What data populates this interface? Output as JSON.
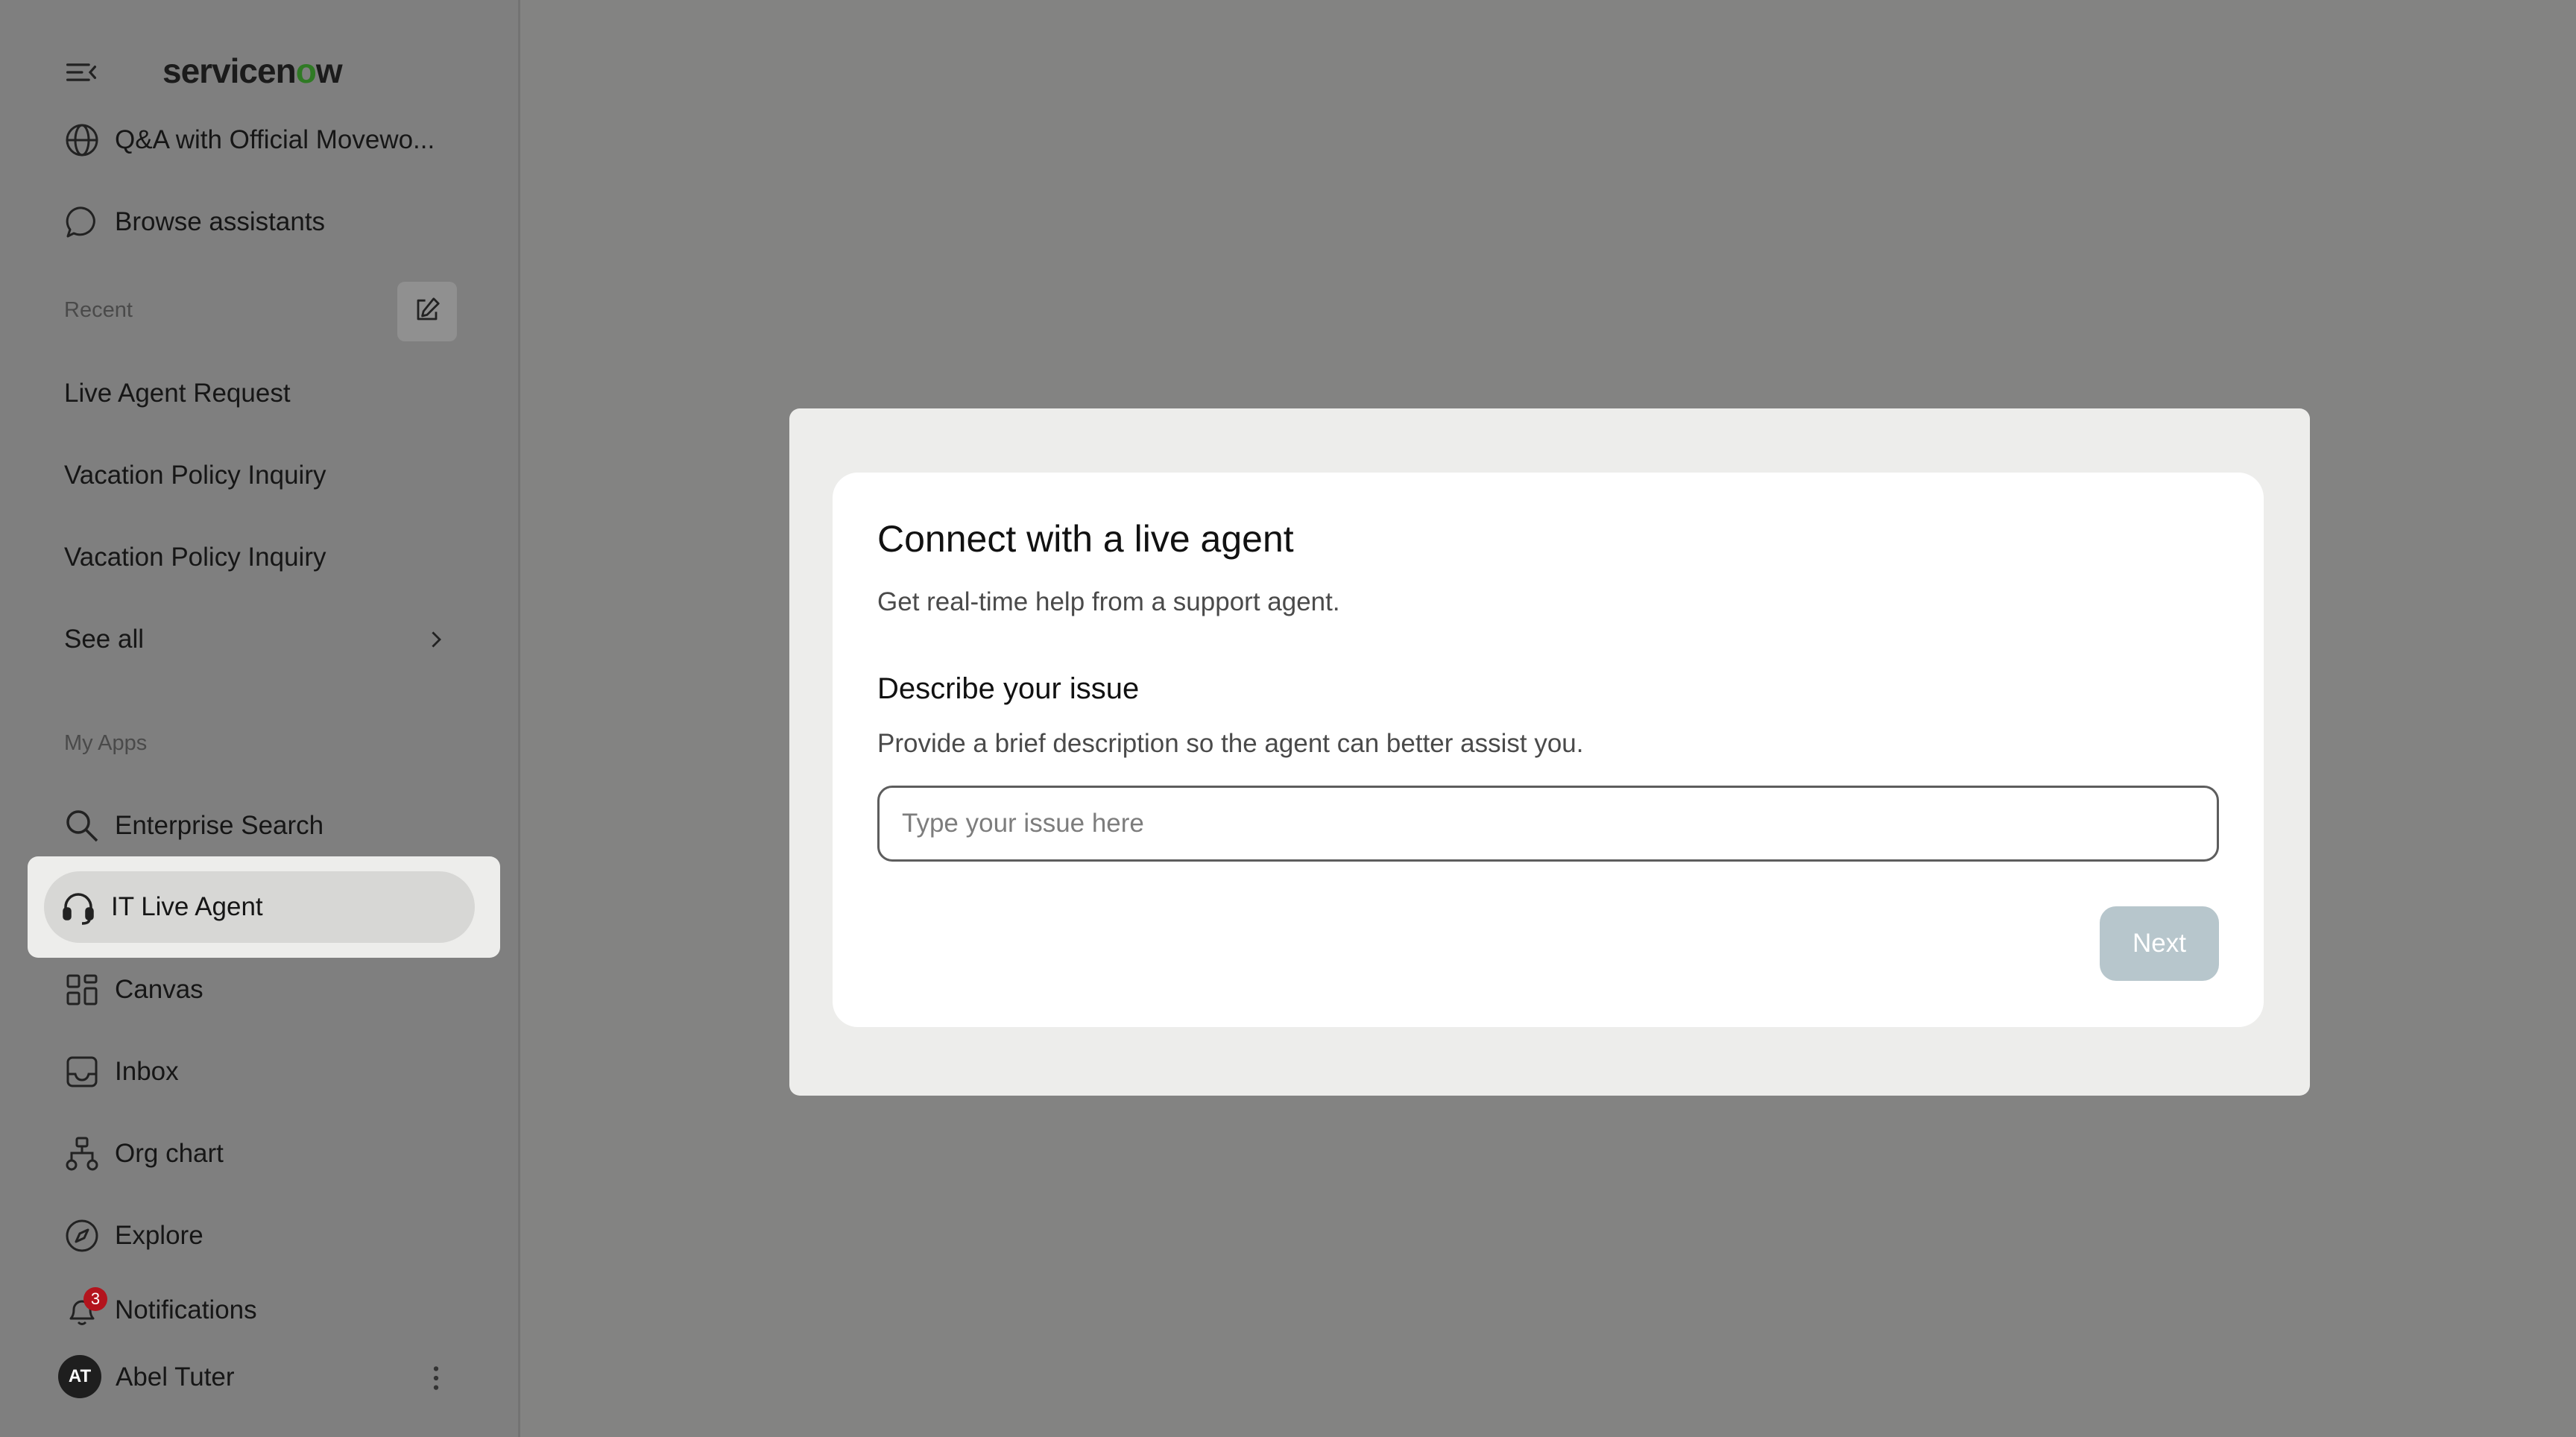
{
  "brand": {
    "logo_text_a": "servicen",
    "logo_text_o": "o",
    "logo_text_b": "w",
    "accent_color": "#2f7a24"
  },
  "sidebar": {
    "assistants": [
      {
        "label": "Q&A with Official Movewo...",
        "icon": "globe-icon"
      },
      {
        "label": "Browse assistants",
        "icon": "chat-bubble-icon"
      }
    ],
    "recent_heading": "Recent",
    "recent": [
      "Live Agent Request",
      "Vacation Policy Inquiry",
      "Vacation Policy Inquiry"
    ],
    "see_all": "See all",
    "apps_heading": "My Apps",
    "apps": [
      {
        "label": "Enterprise Search",
        "icon": "search-icon"
      },
      {
        "label": "IT Live Agent",
        "icon": "headset-icon",
        "active": true
      },
      {
        "label": "Canvas",
        "icon": "grid-icon"
      },
      {
        "label": "Inbox",
        "icon": "inbox-icon"
      },
      {
        "label": "Org chart",
        "icon": "org-chart-icon"
      },
      {
        "label": "Explore",
        "icon": "compass-icon"
      },
      {
        "label": "Notifications",
        "icon": "bell-icon",
        "badge": "3"
      }
    ],
    "user": {
      "initials": "AT",
      "name": "Abel Tuter"
    }
  },
  "dialog": {
    "title": "Connect with a live agent",
    "subtitle": "Get real-time help from a support agent.",
    "section_title": "Describe your issue",
    "section_desc": "Provide a brief description so the agent can better assist you.",
    "input_placeholder": "Type your issue here",
    "input_value": "",
    "next_label": "Next",
    "next_color": "#b7c6cc"
  }
}
